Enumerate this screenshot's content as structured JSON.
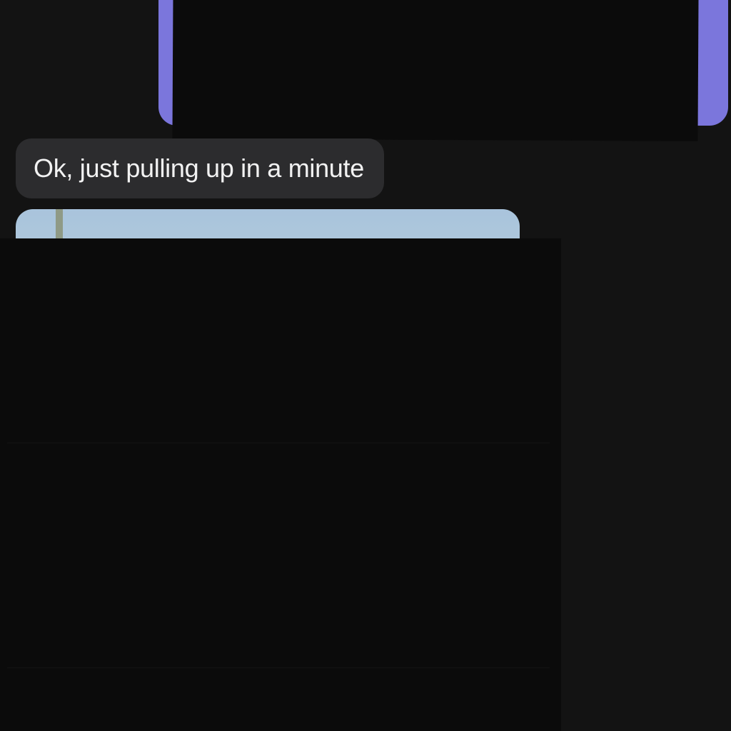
{
  "conversation": {
    "messages": [
      {
        "direction": "sent",
        "type": "text",
        "text": "",
        "redacted": true,
        "bubble_color": "#7b76dc"
      },
      {
        "direction": "received",
        "type": "text",
        "text": "Ok, just pulling up in a minute",
        "bubble_color": "#2c2c2e"
      },
      {
        "direction": "received",
        "type": "image",
        "redacted": true
      }
    ]
  },
  "theme": {
    "background": "#131313",
    "redaction_color": "#0b0b0b",
    "text_color": "#f2f2f2"
  }
}
